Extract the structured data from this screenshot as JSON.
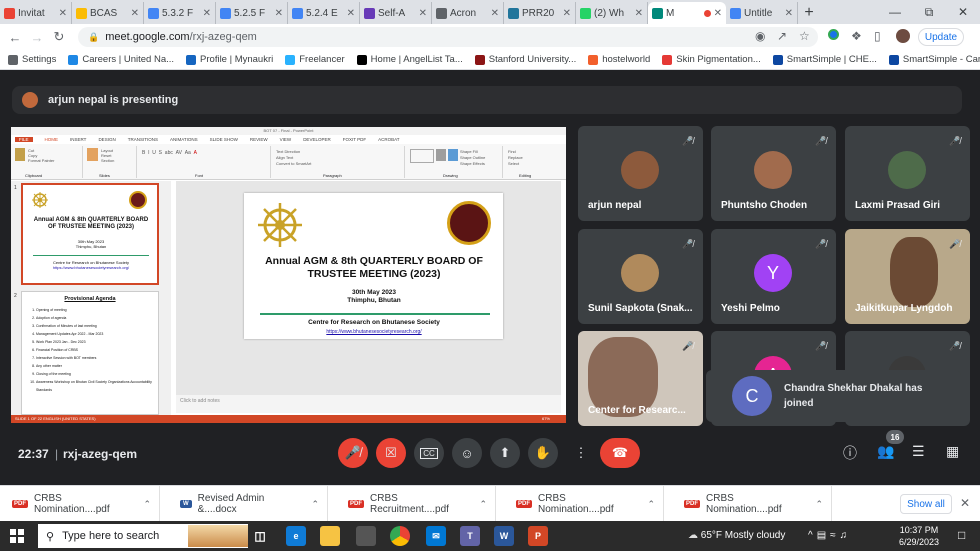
{
  "browser": {
    "tabs": [
      {
        "label": "Invitat",
        "color": "#ea4335",
        "icon": "gmail-icon"
      },
      {
        "label": "BCAS",
        "color": "#fbbc04",
        "icon": "drive-icon"
      },
      {
        "label": "5.3.2 F",
        "color": "#4285f4",
        "icon": "docs-icon"
      },
      {
        "label": "5.2.5 F",
        "color": "#4285f4",
        "icon": "docs-icon"
      },
      {
        "label": "5.2.4 E",
        "color": "#4285f4",
        "icon": "docs-icon"
      },
      {
        "label": "Self-A",
        "color": "#673ab7",
        "icon": "forms-icon"
      },
      {
        "label": "Acron",
        "color": "#5f6368",
        "icon": "globe-icon"
      },
      {
        "label": "PRR20",
        "color": "#21759b",
        "icon": "wordpress-icon"
      },
      {
        "label": "(2) Wh",
        "color": "#25d366",
        "icon": "whatsapp-icon"
      },
      {
        "label": "M",
        "color": "#00897b",
        "icon": "meet-icon"
      },
      {
        "label": "Untitle",
        "color": "#4285f4",
        "icon": "docs-icon"
      }
    ],
    "new_tab": "+",
    "url_domain": "meet.google.com",
    "url_path": "/rxj-azeg-qem",
    "update_label": "Update",
    "bookmarks": [
      {
        "label": "Settings",
        "color": "#5f6368"
      },
      {
        "label": "Careers | United Na...",
        "color": "#1e88e5"
      },
      {
        "label": "Profile | Mynaukri",
        "color": "#1565c0"
      },
      {
        "label": "Freelancer",
        "color": "#29b2fe"
      },
      {
        "label": "Home | AngelList Ta...",
        "color": "#000000"
      },
      {
        "label": "Stanford University...",
        "color": "#8c1515"
      },
      {
        "label": "hostelworld",
        "color": "#f25f2c"
      },
      {
        "label": "Skin Pigmentation...",
        "color": "#e53935"
      },
      {
        "label": "SmartSimple | CHE...",
        "color": "#0d47a1"
      },
      {
        "label": "SmartSimple - Can...",
        "color": "#0d47a1"
      }
    ]
  },
  "meet": {
    "presenting_text": "arjun nepal is presenting",
    "presentation": {
      "window_title": "BOT 07 - Final - PowerPoint",
      "ribbon_tabs": [
        "FILE",
        "HOME",
        "INSERT",
        "DESIGN",
        "TRANSITIONS",
        "ANIMATIONS",
        "SLIDE SHOW",
        "REVIEW",
        "VIEW",
        "DEVELOPER",
        "FOXIT PDF",
        "ACROBAT"
      ],
      "ribbon_groups": [
        "Clipboard",
        "Slides",
        "Font",
        "Paragraph",
        "Drawing",
        "Editing"
      ],
      "slide_title": "Annual AGM & 8th QUARTERLY BOARD OF TRUSTEE MEETING (2023)",
      "slide_date": "30th May 2023",
      "slide_place": "Thimphu, Bhutan",
      "slide_org": "Centre for Research on Bhutanese Society",
      "slide_url": "https://www.bhutanesesocietyresearch.org/",
      "thumb2_title": "Provisional Agenda",
      "agenda": [
        "Opening of meeting",
        "Adoption of agenda",
        "Confirmation of Minutes of last meeting",
        "Management Updates Apr 2022 - Mar 2023",
        "Work Plan 2023 Jan - Dec 2023",
        "Financial Position of CRBS",
        "Interactive Session with BOT members",
        "Any other matter",
        "Closing of the meeting",
        "Awareness Workshop on Bhutan Civil Society Organizations Accountability Standards"
      ],
      "notes_placeholder": "Click to add notes",
      "status_text": "SLIDE 1 OF 22     ENGLISH (UNITED STATES)",
      "zoom": "67%"
    },
    "participants": [
      {
        "name": "arjun nepal",
        "avatar": "#8d5a3c"
      },
      {
        "name": "Phuntsho Choden",
        "avatar": "#a16b4d"
      },
      {
        "name": "Laxmi Prasad Giri",
        "avatar": "#4e6b4a"
      },
      {
        "name": "Sunil Sapkota (Snak...",
        "avatar": "#b08a5c"
      },
      {
        "name": "Yeshi Pelmo",
        "avatar": "#a142f4",
        "initial": "Y"
      },
      {
        "name": "Jaikitkupar Lyngdoh",
        "avatar": "#b8a88a"
      },
      {
        "name": "Center for Researc...",
        "avatar": "#c9b6a2"
      },
      {
        "name": "",
        "avatar": "#e52592",
        "initial": "A"
      },
      {
        "name": "",
        "avatar": "#3a3a3a"
      }
    ],
    "toast": {
      "initial": "C",
      "text": "Chandra Shekhar Dhakal has joined"
    },
    "time": "22:37",
    "meeting_code": "rxj-azeg-qem",
    "participant_count": "16"
  },
  "downloads": {
    "items": [
      {
        "name": "CRBS Nomination....pdf",
        "type": "PDF"
      },
      {
        "name": "Revised Admin &....docx",
        "type": "W"
      },
      {
        "name": "CRBS Recruitment....pdf",
        "type": "PDF"
      },
      {
        "name": "CRBS Nomination....pdf",
        "type": "PDF"
      },
      {
        "name": "CRBS Nomination....pdf",
        "type": "PDF"
      }
    ],
    "show_all": "Show all"
  },
  "taskbar": {
    "search_placeholder": "Type here to search",
    "weather": "65°F  Mostly cloudy",
    "time": "10:37 PM",
    "date": "6/29/2023"
  }
}
